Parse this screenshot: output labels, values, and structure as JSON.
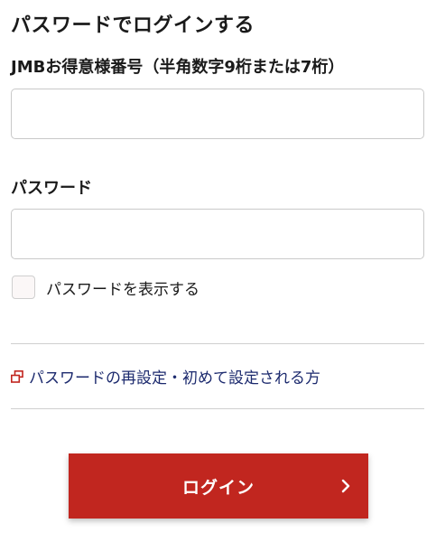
{
  "page": {
    "title": "パスワードでログインする"
  },
  "form": {
    "jmb_label": "JMBお得意様番号（半角数字9桁または7桁）",
    "jmb_value": "",
    "password_label": "パスワード",
    "password_value": "",
    "show_password_label": "パスワードを表示する",
    "show_password_checked": false
  },
  "links": {
    "reset_password": "パスワードの再設定・初めて設定される方"
  },
  "buttons": {
    "login_label": "ログイン"
  },
  "icons": {
    "external_link": "external-link-icon",
    "login_chevron": "chevron-right-icon"
  },
  "colors": {
    "primary_button": "#c1261f",
    "link_text": "#1c2a6e",
    "external_icon": "#c1261f",
    "divider": "#cfcfcf"
  }
}
